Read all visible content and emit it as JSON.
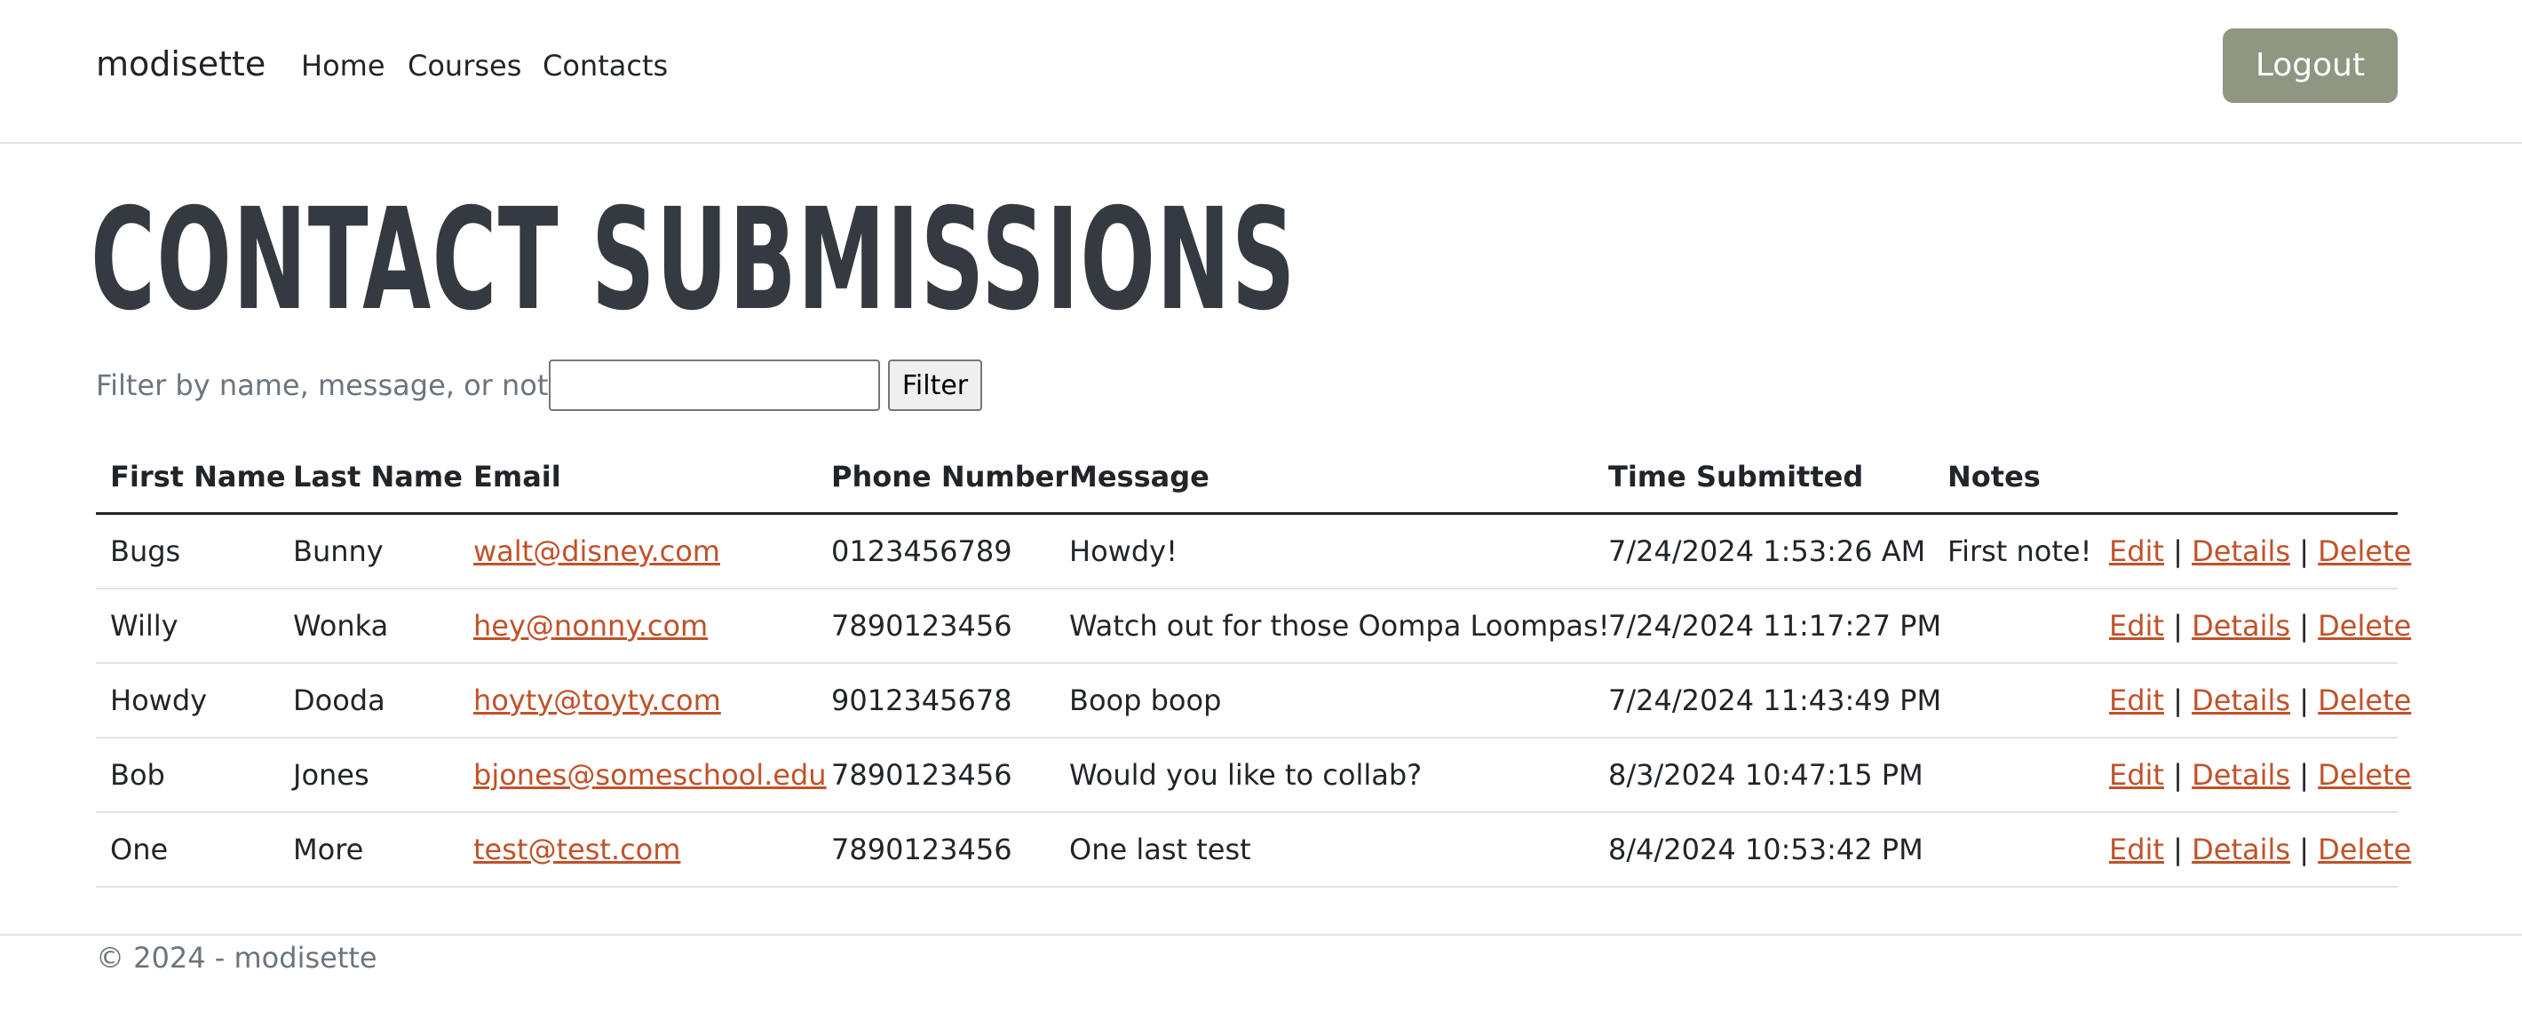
{
  "nav": {
    "brand": "modisette",
    "links": [
      "Home",
      "Courses",
      "Contacts"
    ],
    "logout_label": "Logout",
    "logout_color": "#8f9783"
  },
  "page": {
    "title": "CONTACT SUBMISSIONS"
  },
  "filter": {
    "label": "Filter by name, message, or notes:",
    "value": "",
    "button_label": "Filter"
  },
  "table": {
    "headers": [
      "First Name",
      "Last Name",
      "Email",
      "Phone Number",
      "Message",
      "Time Submitted",
      "Notes",
      ""
    ],
    "action_labels": {
      "edit": "Edit",
      "details": "Details",
      "delete": "Delete",
      "separator": "|"
    },
    "link_color": "#c0522a",
    "rows": [
      {
        "first": "Bugs",
        "last": "Bunny",
        "email": "walt@disney.com",
        "phone": "0123456789",
        "message": "Howdy!",
        "time": "7/24/2024 1:53:26 AM",
        "notes": "First note!"
      },
      {
        "first": "Willy",
        "last": "Wonka",
        "email": "hey@nonny.com",
        "phone": "7890123456",
        "message": "Watch out for those Oompa Loompas!",
        "time": "7/24/2024 11:17:27 PM",
        "notes": ""
      },
      {
        "first": "Howdy",
        "last": "Dooda",
        "email": "hoyty@toyty.com",
        "phone": "9012345678",
        "message": "Boop boop",
        "time": "7/24/2024 11:43:49 PM",
        "notes": ""
      },
      {
        "first": "Bob",
        "last": "Jones",
        "email": "bjones@someschool.edu",
        "phone": "7890123456",
        "message": "Would you like to collab?",
        "time": "8/3/2024 10:47:15 PM",
        "notes": ""
      },
      {
        "first": "One",
        "last": "More",
        "email": "test@test.com",
        "phone": "7890123456",
        "message": "One last test",
        "time": "8/4/2024 10:53:42 PM",
        "notes": ""
      }
    ]
  },
  "footer": {
    "text": "© 2024 - modisette"
  }
}
